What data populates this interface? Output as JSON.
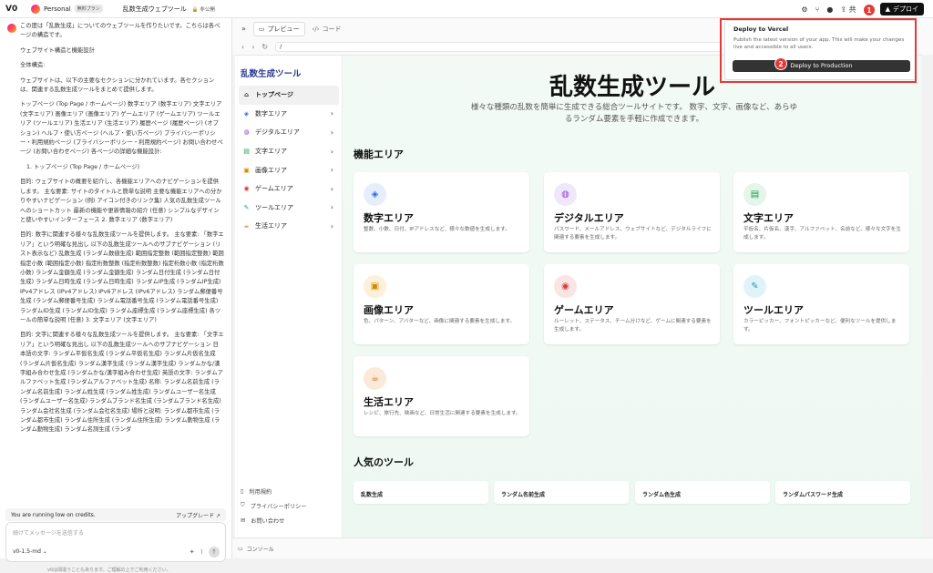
{
  "topbar": {
    "logo": "V0",
    "workspace": "Personal",
    "plan": "無料プラン",
    "project_title": "乱数生成ウェブツール",
    "visibility": "非公開",
    "share_label": "共",
    "deploy_label": "デプロイ"
  },
  "chat": {
    "paragraphs": [
      "この度は「乱数生成」についてのウェブツールを作りたいです。こちらは各ページの構造です。",
      "ウェブサイト構造と機能設計",
      "全体構造:",
      "ウェブサイトは、以下の主要なセクションに分かれています。各セクションは、関連する乱数生成ツールをまとめて提供します。",
      "トップページ (Top Page / ホームページ) 数字エリア (数字エリア) 文字エリア (文字エリア) 画像エリア (画像エリア) ゲームエリア (ゲームエリア) ツールエリア (ツールエリア) 生活エリア (生活エリア) 履歴ページ (履歴ページ) (オプション) ヘルプ・使い方ページ (ヘルプ・使い方ページ) プライバシーポリシー・利用規約ページ (プライバシーポリシー・利用規約ページ) お問い合わせページ (お問い合わせページ) 各ページの詳細な機能設計:",
      "1. トップページ (Top Page / ホームページ)",
      "目的: ウェブサイトの概要を紹介し、各機能エリアへのナビゲーションを提供します。 主な要素: サイトのタイトルと簡単な説明 主要な機能エリアへの分かりやすいナビゲーション (例) アイコン付きのリンク集) 人気の乱数生成ツールへのショートカット 最新の機能や更新情報の紹介 (任意) シンプルなデザインと使いやすいインターフェース 2. 数字エリア (数字エリア)",
      "目的: 数字に関連する様々な乱数生成ツールを提供します。 主な要素: 「数字エリア」という明確な見出し 以下の乱数生成ツールへのサブナビゲーション (リスト表示など) 乱数生成 (ランダム数値生成) 範囲指定整数 (範囲指定整数) 範囲指定小数 (範囲指定小数) 指定桁数整数 (指定桁数整数) 指定桁数小数 (指定桁数小数) ランダム金額生成 (ランダム金額生成) ランダム日付生成 (ランダム日付生成) ランダム日時生成 (ランダム日時生成) ランダムIP生成 (ランダムIP生成) IPv4アドレス (IPv4アドレス) IPv6アドレス (IPv6アドレス) ランダム郵便番号生成 (ランダム郵便番号生成) ランダム電話番号生成 (ランダム電話番号生成) ランダムID生成 (ランダムID生成) ランダム座標生成 (ランダム座標生成) 各ツールの簡単な説明 (任意) 3. 文字エリア (文字エリア)",
      "目的: 文字に関連する様々な乱数生成ツールを提供します。 主な要素: 「文字エリア」という明確な見出し 以下の乱数生成ツールへのサブナビゲーション 日本語の文字: ランダム平仮名生成 (ランダム平仮名生成) ランダム片仮名生成 (ランダム片仮名生成) ランダム漢字生成 (ランダム漢字生成) ランダムかな/漢字組み合わせ生成 (ランダムかな/漢字組み合わせ生成) 英語の文字: ランダムアルファベット生成 (ランダムアルファベット生成) 名称: ランダム名前生成 (ランダム名前生成) ランダム姓生成 (ランダム姓生成) ランダムユーザー名生成 (ランダムユーザー名生成) ランダムブランド名生成 (ランダムブランド名生成) ランダム会社名生成 (ランダム会社名生成) 場所と説明: ランダム都市生成 (ランダム都市生成) ランダム住所生成 (ランダム住所生成) ランダム動物生成 (ランダム動物生成) ランダム名詞生成 (ランダ"
    ],
    "credits_text": "You are running low on credits.",
    "upgrade_label": "アップグレード ↗",
    "input_placeholder": "続けてメッセージを送信する",
    "model": "v0-1.5-md ⌄",
    "disclaimer": "v0は間違うこともあります。ご理解の上でご利用ください。"
  },
  "preview": {
    "tab_preview": "プレビュー",
    "tab_code": "コード",
    "url": "/",
    "console": "コンソール"
  },
  "site": {
    "title": "乱数生成ツール",
    "nav": [
      {
        "label": "トップページ",
        "icon": "home-icon",
        "glyph": "⌂",
        "color": "#333"
      },
      {
        "label": "数字エリア",
        "icon": "number-icon",
        "glyph": "◈",
        "color": "#2e6be6"
      },
      {
        "label": "デジタルエリア",
        "icon": "globe-icon",
        "glyph": "◍",
        "color": "#8b3fd6"
      },
      {
        "label": "文字エリア",
        "icon": "document-icon",
        "glyph": "▤",
        "color": "#1a9c4f"
      },
      {
        "label": "画像エリア",
        "icon": "image-icon",
        "glyph": "▣",
        "color": "#d48a00"
      },
      {
        "label": "ゲームエリア",
        "icon": "gamepad-icon",
        "glyph": "◉",
        "color": "#d23f3f"
      },
      {
        "label": "ツールエリア",
        "icon": "wrench-icon",
        "glyph": "✎",
        "color": "#1a9cb8"
      },
      {
        "label": "生活エリア",
        "icon": "coffee-icon",
        "glyph": "☕",
        "color": "#c86a1a"
      }
    ],
    "footer": [
      {
        "label": "利用規約",
        "icon": "file-icon",
        "glyph": "▯"
      },
      {
        "label": "プライバシーポリシー",
        "icon": "shield-icon",
        "glyph": "⛉"
      },
      {
        "label": "お問い合わせ",
        "icon": "mail-icon",
        "glyph": "✉"
      }
    ],
    "hero_title": "乱数生成ツール",
    "hero_sub": "様々な種類の乱数を簡単に生成できる総合ツールサイトです。 数字、文字、画像など、あらゆるランダム要素を手軽に作成できます。",
    "features_heading": "機能エリア",
    "cards": [
      {
        "title": "数字エリア",
        "desc": "整数、小数、日付、IPアドレスなど、様々な数値を生成します。",
        "icon": "number-icon",
        "glyph": "◈",
        "color": "#2e6be6",
        "bg": "#e6eefc"
      },
      {
        "title": "デジタルエリア",
        "desc": "パスワード、メールアドレス、ウェブサイトなど、デジタルライフに関連する要素を生成します。",
        "icon": "globe-icon",
        "glyph": "◍",
        "color": "#8b3fd6",
        "bg": "#f1e7fb"
      },
      {
        "title": "文字エリア",
        "desc": "平仮名、片仮名、漢字、アルファベット、名前など、様々な文字を生成します。",
        "icon": "document-icon",
        "glyph": "▤",
        "color": "#1a9c4f",
        "bg": "#e4f5ea"
      },
      {
        "title": "画像エリア",
        "desc": "色、パターン、アバターなど、画像に関連する要素を生成します。",
        "icon": "image-icon",
        "glyph": "▣",
        "color": "#d48a00",
        "bg": "#fcf1d8"
      },
      {
        "title": "ゲームエリア",
        "desc": "ルーレット、ステータス、チーム分けなど、ゲームに関連する要素を生成します。",
        "icon": "gamepad-icon",
        "glyph": "◉",
        "color": "#d23f3f",
        "bg": "#fbe4e4"
      },
      {
        "title": "ツールエリア",
        "desc": "カラーピッカー、フォントピッカーなど、便利なツールを提供します。",
        "icon": "wrench-icon",
        "glyph": "✎",
        "color": "#1a9cb8",
        "bg": "#e0f3f8"
      },
      {
        "title": "生活エリア",
        "desc": "レシピ、旅行先、映画など、日常生活に関連する要素を生成します。",
        "icon": "coffee-icon",
        "glyph": "☕",
        "color": "#c86a1a",
        "bg": "#fbeada"
      }
    ],
    "popular_heading": "人気のツール",
    "popular": [
      "乱数生成",
      "ランダム名前生成",
      "ランダム色生成",
      "ランダムパスワード生成"
    ]
  },
  "deploy_panel": {
    "title": "Deploy to Vercel",
    "desc": "Publish the latest version of your app. This will make your changes live and accessible to all users.",
    "button": "Deploy to Production"
  },
  "markers": [
    "1",
    "2"
  ],
  "colors": {
    "highlight": "#e53935",
    "site_title": "#2b3a90",
    "deploy_button": "#111111"
  }
}
